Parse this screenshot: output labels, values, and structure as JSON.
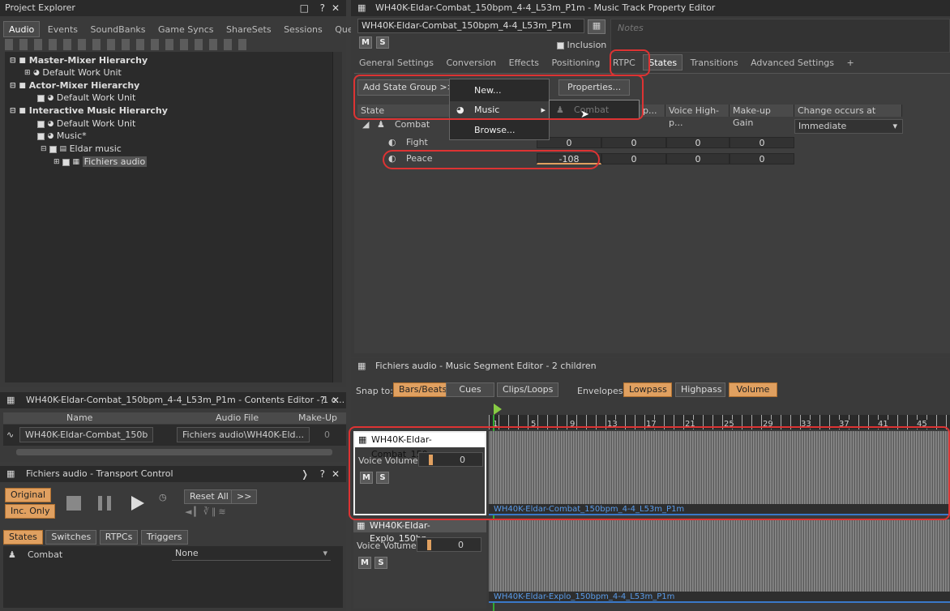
{
  "project_explorer": {
    "title": "Project Explorer",
    "tabs": [
      "Audio",
      "Events",
      "SoundBanks",
      "Game Syncs",
      "ShareSets",
      "Sessions",
      "Queries"
    ],
    "active_tab": "Audio",
    "tree": [
      {
        "label": "Master-Mixer Hierarchy",
        "bold": true
      },
      {
        "label": "Default Work Unit"
      },
      {
        "label": "Actor-Mixer Hierarchy",
        "bold": true
      },
      {
        "label": "Default Work Unit"
      },
      {
        "label": "Interactive Music Hierarchy",
        "bold": true
      },
      {
        "label": "Default Work Unit"
      },
      {
        "label": "Music*"
      },
      {
        "label": "Eldar music"
      },
      {
        "label": "Fichiers audio"
      }
    ]
  },
  "contents_editor": {
    "title": "WH40K-Eldar-Combat_150bpm_4-4_L53m_P1m - Contents Editor - 1 c...",
    "columns": [
      "Name",
      "Audio File",
      "Make-Up Ga"
    ],
    "row": {
      "name": "WH40K-Eldar-Combat_150b",
      "audio_file": "Fichiers audio\\WH40K-Eld...",
      "makeup": "0"
    }
  },
  "transport": {
    "title": "Fichiers audio - Transport Control",
    "original": "Original",
    "inc_only": "Inc. Only",
    "reset_all": "Reset All",
    "more": ">>",
    "tabs": [
      "States",
      "Switches",
      "RTPCs",
      "Triggers"
    ],
    "state_group": "Combat",
    "state_value": "None"
  },
  "property_editor": {
    "title": "WH40K-Eldar-Combat_150bpm_4-4_L53m_P1m - Music Track Property Editor",
    "object_name": "WH40K-Eldar-Combat_150bpm_4-4_L53m_P1m",
    "notes_placeholder": "Notes",
    "inclusion": "Inclusion",
    "m": "M",
    "s": "S",
    "tabs": [
      "General Settings",
      "Conversion",
      "Effects",
      "Positioning",
      "RTPC",
      "States",
      "Transitions",
      "Advanced Settings",
      "+"
    ],
    "active_tab": "States",
    "add_state_group": "Add State Group >>",
    "properties": "Properties...",
    "columns": [
      "State",
      "p...",
      "Voice High-p...",
      "Make-up Gain",
      "Change occurs at"
    ],
    "group": "Combat",
    "change_occurs": "Immediate",
    "rows": [
      {
        "label": "Fight",
        "values": [
          "0",
          "0",
          "0",
          "0"
        ]
      },
      {
        "label": "Peace",
        "values": [
          "-108",
          "0",
          "0",
          "0"
        ]
      }
    ],
    "menu": {
      "new": "New...",
      "music": "Music",
      "browse": "Browse...",
      "submenu": "Combat"
    }
  },
  "segment_editor": {
    "title": "Fichiers audio - Music Segment Editor - 2 children",
    "snap_to": "Snap to:",
    "snap_buttons": [
      "Bars/Beats",
      "Cues",
      "Clips/Loops"
    ],
    "envelopes": "Envelopes:",
    "envelope_buttons": [
      "Lowpass",
      "Highpass",
      "Volume"
    ],
    "ruler_marks": [
      "1",
      "5",
      "9",
      "13",
      "17",
      "21",
      "25",
      "29",
      "33",
      "37",
      "41",
      "45"
    ],
    "tracks": [
      {
        "name": "WH40K-Eldar-Combat_150...",
        "voice_volume_label": "Voice Volume",
        "value": "0",
        "clip": "WH40K-Eldar-Combat_150bpm_4-4_L53m_P1m"
      },
      {
        "name": "WH40K-Eldar-Explo_150bp...",
        "voice_volume_label": "Voice Volume",
        "value": "0",
        "clip": "WH40K-Eldar-Explo_150bpm_4-4_L53m_P1m"
      }
    ]
  },
  "colors": {
    "accent_orange": "#e0a060",
    "highlight_red": "#d33333",
    "clip_blue": "#3a78c8"
  }
}
